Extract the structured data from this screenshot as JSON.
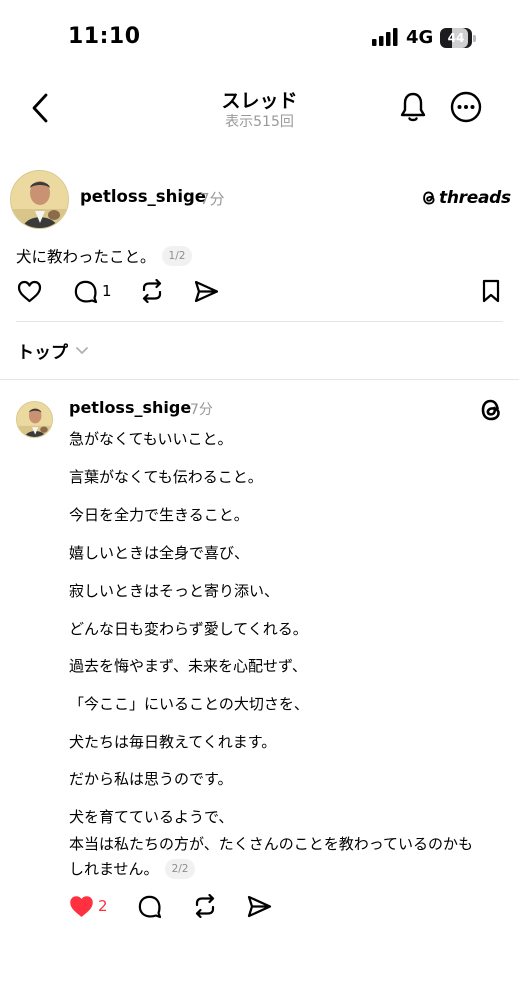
{
  "status_bar": {
    "time": "11:10",
    "network": "4G",
    "battery": "44",
    "battery_level": 0.44
  },
  "nav": {
    "title": "スレッド",
    "subtitle": "表示515回"
  },
  "post": {
    "username": "petloss_shige",
    "time": "7分",
    "threads_logo": "threads",
    "text": "犬に教わったこと。",
    "page_badge": "1/2",
    "reply_count": "1"
  },
  "sort": {
    "label": "トップ"
  },
  "reply": {
    "username": "petloss_shige",
    "time": "7分",
    "lines": [
      "急がなくてもいいこと。",
      "言葉がなくても伝わること。",
      "今日を全力で生きること。",
      "嬉しいときは全身で喜び、",
      "寂しいときはそっと寄り添い、",
      "どんな日も変わらず愛してくれる。",
      "過去を悔やまず、未来を心配せず、",
      "「今ここ」にいることの大切さを、",
      "犬たちは毎日教えてくれます。",
      "だから私は思うのです。",
      "犬を育てているようで、",
      "本当は私たちの方が、たくさんのことを教わっているのかも",
      "しれません。"
    ],
    "page_badge": "2/2",
    "like_count": "2",
    "like_color": "#ff3040"
  },
  "icons": [
    "signal-icon",
    "battery-icon",
    "back-icon",
    "bell-icon",
    "more-icon",
    "threads-icon",
    "heart-icon",
    "comment-icon",
    "repost-icon",
    "share-icon",
    "bookmark-icon",
    "chevron-down-icon"
  ]
}
